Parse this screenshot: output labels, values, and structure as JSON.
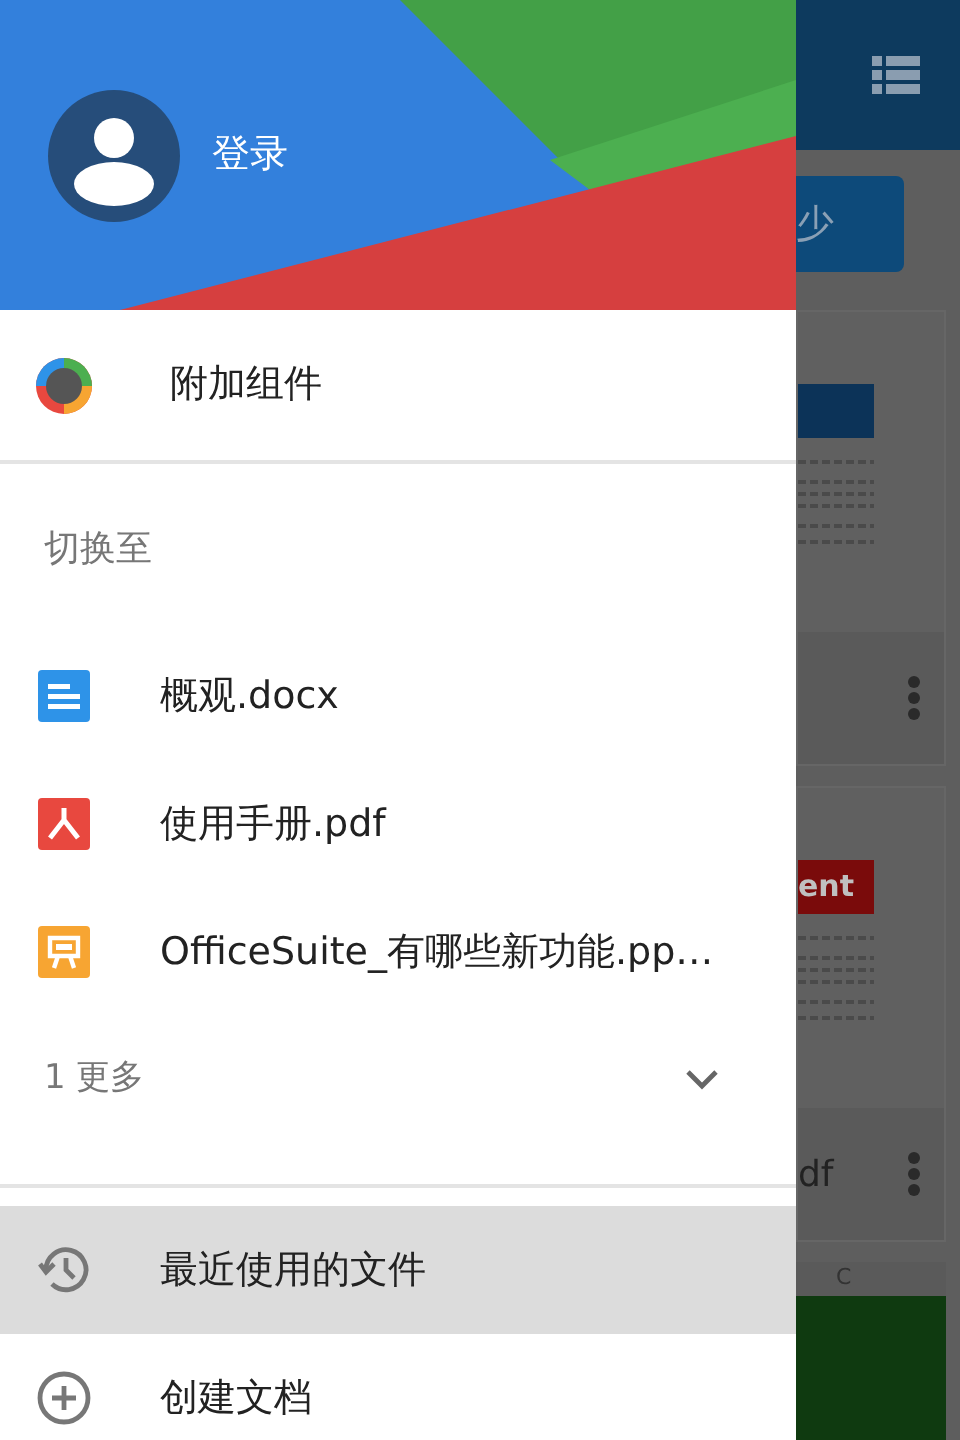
{
  "drawer": {
    "account": {
      "label": "登录"
    },
    "addons": {
      "label": "附加组件"
    },
    "switch_to": {
      "heading": "切换至",
      "files": [
        {
          "name": "概观.docx",
          "kind": "doc"
        },
        {
          "name": "使用手册.pdf",
          "kind": "pdf"
        },
        {
          "name": "OfficeSuite_有哪些新功能.pp…",
          "kind": "ppt"
        }
      ],
      "more": {
        "label": "1 更多",
        "expanded": false
      }
    },
    "menu": [
      {
        "label": "最近使用的文件",
        "kind": "recent",
        "selected": true
      },
      {
        "label": "创建文档",
        "kind": "create",
        "selected": false
      }
    ]
  },
  "background": {
    "button_label": "少",
    "cards": [
      {
        "kind": "document"
      },
      {
        "kind": "document",
        "banner": "ent",
        "caption": "df"
      }
    ],
    "sheet_column": "C"
  }
}
